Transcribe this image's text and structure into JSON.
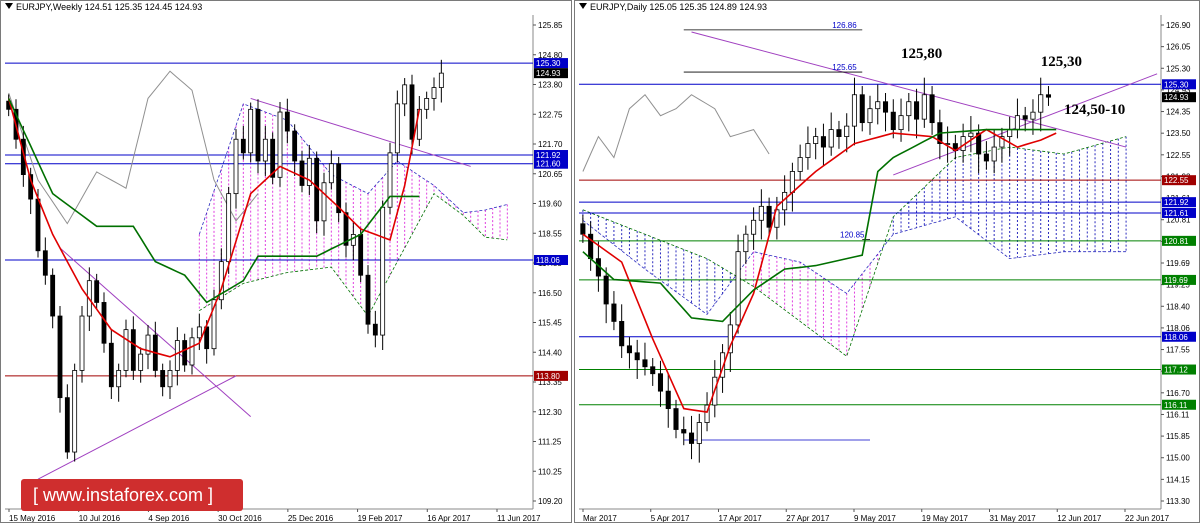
{
  "colors": {
    "price": "#000000",
    "tenkan": "#e00000",
    "kijun": "#007000",
    "chikou": "#909090",
    "cloud_bull": "#2c2cbf",
    "cloud_bear": "#e040e0",
    "trendline": "#a040c0",
    "level_blue": "#0000c8",
    "level_red": "#a00000",
    "level_green": "#008000"
  },
  "watermark": {
    "text": "[ www.instaforex.com ]"
  },
  "chart_data": [
    {
      "type": "candlestick",
      "id": "weekly",
      "title": "EURJPY,Weekly  124.51 125.35 124.45 124.93",
      "ylim": [
        109.2,
        126.7
      ],
      "yticks": [
        "125.85",
        "124.80",
        "123.80",
        "122.75",
        "121.70",
        "120.65",
        "119.60",
        "118.55",
        "117.55",
        "116.50",
        "115.45",
        "114.40",
        "113.35",
        "112.30",
        "111.25",
        "110.25",
        "109.20"
      ],
      "xticks": [
        "15 May 2016",
        "10 Jul 2016",
        "4 Sep 2016",
        "30 Oct 2016",
        "25 Dec 2016",
        "19 Feb 2017",
        "16 Apr 2017",
        "11 Jun 2017"
      ],
      "price_labels": [
        {
          "text": "125.30",
          "value": 125.3,
          "color": "#0000c8"
        },
        {
          "text": "124.93",
          "value": 124.93,
          "color": "#000000"
        },
        {
          "text": "121.92",
          "value": 121.92,
          "color": "#0000c8"
        },
        {
          "text": "121.60",
          "value": 121.6,
          "color": "#0000c8"
        },
        {
          "text": "118.06",
          "value": 118.06,
          "color": "#0000c8"
        },
        {
          "text": "113.80",
          "value": 113.8,
          "color": "#a00000"
        }
      ],
      "hlines": [
        {
          "value": 125.3,
          "color": "#0000c8",
          "x0": 0.0
        },
        {
          "value": 121.92,
          "color": "#0000c8",
          "x0": 0.0
        },
        {
          "value": 121.6,
          "color": "#0000c8",
          "x0": 0.0
        },
        {
          "value": 118.06,
          "color": "#0000c8",
          "x0": 0.0
        },
        {
          "value": 113.8,
          "color": "#a00000",
          "x0": 0.0
        }
      ],
      "closes": [
        123.6,
        122.5,
        121.2,
        120.3,
        118.4,
        117.5,
        116.0,
        113.0,
        111.0,
        114.0,
        116.0,
        117.3,
        116.5,
        115.0,
        113.4,
        114.0,
        115.5,
        114.0,
        114.6,
        115.3,
        114.0,
        113.4,
        114.0,
        115.1,
        114.2,
        115.2,
        115.6,
        114.8,
        116.6,
        118.0,
        120.5,
        122.5,
        122.0,
        123.6,
        121.7,
        122.5,
        121.1,
        123.5,
        122.8,
        121.7,
        120.8,
        121.8,
        119.5,
        120.9,
        121.6,
        119.8,
        118.6,
        119.0,
        117.5,
        115.7,
        115.3,
        120.0,
        122.0,
        123.8,
        124.5,
        122.5,
        123.6,
        124.0,
        124.4,
        124.93
      ],
      "tenkan": [
        {
          "i": 0,
          "v": 124.0
        },
        {
          "i": 3,
          "v": 121.0
        },
        {
          "i": 6,
          "v": 119.0
        },
        {
          "i": 10,
          "v": 117.0
        },
        {
          "i": 14,
          "v": 115.5
        },
        {
          "i": 18,
          "v": 114.8
        },
        {
          "i": 22,
          "v": 114.5
        },
        {
          "i": 26,
          "v": 115.0
        },
        {
          "i": 29,
          "v": 117.0
        },
        {
          "i": 33,
          "v": 120.5
        },
        {
          "i": 37,
          "v": 121.5
        },
        {
          "i": 41,
          "v": 121.0
        },
        {
          "i": 45,
          "v": 120.0
        },
        {
          "i": 48,
          "v": 119.2
        },
        {
          "i": 52,
          "v": 118.8
        },
        {
          "i": 54,
          "v": 120.8
        },
        {
          "i": 56,
          "v": 123.6
        }
      ],
      "kijun": [
        {
          "i": 0,
          "v": 124.0
        },
        {
          "i": 6,
          "v": 120.5
        },
        {
          "i": 12,
          "v": 119.3
        },
        {
          "i": 17,
          "v": 119.3
        },
        {
          "i": 20,
          "v": 118.0
        },
        {
          "i": 24,
          "v": 117.5
        },
        {
          "i": 27,
          "v": 116.5
        },
        {
          "i": 32,
          "v": 117.3
        },
        {
          "i": 34,
          "v": 118.2
        },
        {
          "i": 42,
          "v": 118.2
        },
        {
          "i": 48,
          "v": 119.0
        },
        {
          "i": 52,
          "v": 120.4
        },
        {
          "i": 56,
          "v": 120.4
        }
      ],
      "chikou": [
        {
          "i": 0,
          "v": 124.2
        },
        {
          "i": 4,
          "v": 121.0
        },
        {
          "i": 8,
          "v": 119.4
        },
        {
          "i": 12,
          "v": 121.3
        },
        {
          "i": 16,
          "v": 120.7
        },
        {
          "i": 19,
          "v": 124.0
        },
        {
          "i": 22,
          "v": 125.0
        },
        {
          "i": 25,
          "v": 124.3
        },
        {
          "i": 28,
          "v": 121.0
        },
        {
          "i": 31,
          "v": 119.5
        },
        {
          "i": 34,
          "v": 120.5
        }
      ],
      "cloud": [
        {
          "i": 26,
          "a": 116.2,
          "b": 119.0
        },
        {
          "i": 32,
          "a": 117.2,
          "b": 123.8
        },
        {
          "i": 38,
          "a": 117.6,
          "b": 123.2
        },
        {
          "i": 44,
          "a": 117.8,
          "b": 121.2
        },
        {
          "i": 49,
          "a": 116.0,
          "b": 120.5
        },
        {
          "i": 53,
          "a": 118.0,
          "b": 121.7
        },
        {
          "i": 58,
          "a": 120.5,
          "b": 120.8
        },
        {
          "i": 62,
          "a": 119.7,
          "b": 119.8
        },
        {
          "i": 65,
          "a": 118.9,
          "b": 119.9
        },
        {
          "i": 68,
          "a": 118.8,
          "b": 120.1
        }
      ],
      "trendlines": [
        {
          "i1": 33,
          "v1": 124.0,
          "i2": 63,
          "v2": 121.5
        },
        {
          "i1": 7,
          "v1": 118.5,
          "i2": 33,
          "v2": 112.3
        },
        {
          "i1": 4,
          "v1": 110.0,
          "i2": 31,
          "v2": 113.8
        }
      ],
      "n": 72
    },
    {
      "type": "candlestick",
      "id": "daily",
      "title": "EURJPY,Daily  125.05 125.35 124.89 124.93",
      "ylim": [
        113.35,
        127.0
      ],
      "yticks": [
        "126.90",
        "126.05",
        "125.30",
        "124.93",
        "124.35",
        "123.50",
        "122.55",
        "121.92",
        "121.61",
        "120.81",
        "120.10",
        "119.69",
        "119.25",
        "118.40",
        "118.06",
        "117.55",
        "117.12",
        "116.70",
        "116.11",
        "115.85",
        "115.00",
        "114.15",
        "113.30"
      ],
      "xticks": [
        "Mar 2017",
        "5 Apr 2017",
        "17 Apr 2017",
        "27 Apr 2017",
        "9 May 2017",
        "19 May 2017",
        "31 May 2017",
        "12 Jun 2017",
        "22 Jun 2017"
      ],
      "price_labels": [
        {
          "text": "125.30",
          "value": 125.3,
          "color": "#0000c8"
        },
        {
          "text": "124.93",
          "value": 124.93,
          "color": "#000000"
        },
        {
          "text": "122.55",
          "value": 122.55,
          "color": "#a00000"
        },
        {
          "text": "121.92",
          "value": 121.92,
          "color": "#0000c8"
        },
        {
          "text": "121.61",
          "value": 121.61,
          "color": "#0000c8"
        },
        {
          "text": "120.81",
          "value": 120.81,
          "color": "#008000"
        },
        {
          "text": "119.69",
          "value": 119.69,
          "color": "#008000"
        },
        {
          "text": "118.06",
          "value": 118.06,
          "color": "#0000c8"
        },
        {
          "text": "117.12",
          "value": 117.12,
          "color": "#008000"
        },
        {
          "text": "116.11",
          "value": 116.11,
          "color": "#008000"
        }
      ],
      "hlines": [
        {
          "value": 125.3,
          "color": "#0000c8",
          "x0": 0.0
        },
        {
          "value": 122.55,
          "color": "#a00000",
          "x0": 0.0
        },
        {
          "value": 121.92,
          "color": "#0000c8",
          "x0": 0.0
        },
        {
          "value": 121.61,
          "color": "#0000c8",
          "x0": 0.0
        },
        {
          "value": 120.81,
          "color": "#008000",
          "x0": 0.0
        },
        {
          "value": 119.69,
          "color": "#008000",
          "x0": 0.0
        },
        {
          "value": 118.06,
          "color": "#0000c8",
          "x0": 0.0
        },
        {
          "value": 117.12,
          "color": "#008000",
          "x0": 0.0
        },
        {
          "value": 116.11,
          "color": "#008000",
          "x0": 0.0
        }
      ],
      "closes": [
        121.0,
        120.3,
        119.8,
        119.0,
        118.5,
        117.8,
        117.6,
        117.4,
        117.2,
        117.0,
        116.5,
        116.0,
        115.4,
        115.3,
        115.0,
        115.6,
        116.1,
        116.9,
        117.6,
        118.4,
        120.5,
        121.0,
        121.4,
        121.8,
        121.2,
        121.7,
        122.2,
        122.8,
        123.2,
        123.6,
        123.8,
        123.5,
        124.0,
        123.8,
        124.1,
        125.0,
        124.2,
        124.6,
        124.8,
        124.5,
        124.0,
        124.4,
        124.8,
        124.3,
        125.0,
        124.2,
        123.6,
        123.6,
        123.4,
        123.8,
        123.9,
        123.3,
        123.1,
        123.5,
        123.8,
        124.0,
        124.4,
        124.3,
        124.5,
        125.0,
        124.93
      ],
      "tenkan": [
        {
          "i": 0,
          "v": 121.0
        },
        {
          "i": 5,
          "v": 120.2
        },
        {
          "i": 9,
          "v": 118.0
        },
        {
          "i": 13,
          "v": 116.0
        },
        {
          "i": 16,
          "v": 115.9
        },
        {
          "i": 19,
          "v": 117.8
        },
        {
          "i": 22,
          "v": 119.3
        },
        {
          "i": 25,
          "v": 121.8
        },
        {
          "i": 30,
          "v": 122.8
        },
        {
          "i": 35,
          "v": 123.6
        },
        {
          "i": 40,
          "v": 123.9
        },
        {
          "i": 45,
          "v": 123.8
        },
        {
          "i": 48,
          "v": 123.4
        },
        {
          "i": 52,
          "v": 124.0
        },
        {
          "i": 56,
          "v": 123.5
        },
        {
          "i": 59,
          "v": 123.7
        },
        {
          "i": 61,
          "v": 123.9
        }
      ],
      "kijun": [
        {
          "i": 0,
          "v": 120.5
        },
        {
          "i": 4,
          "v": 119.7
        },
        {
          "i": 10,
          "v": 119.6
        },
        {
          "i": 14,
          "v": 118.6
        },
        {
          "i": 18,
          "v": 118.5
        },
        {
          "i": 22,
          "v": 119.4
        },
        {
          "i": 26,
          "v": 120.0
        },
        {
          "i": 30,
          "v": 120.1
        },
        {
          "i": 36,
          "v": 120.4
        },
        {
          "i": 38,
          "v": 122.8
        },
        {
          "i": 40,
          "v": 123.2
        },
        {
          "i": 46,
          "v": 123.9
        },
        {
          "i": 52,
          "v": 124.0
        },
        {
          "i": 61,
          "v": 124.0
        }
      ],
      "chikou": [
        {
          "i": 0,
          "v": 122.8
        },
        {
          "i": 2,
          "v": 123.8
        },
        {
          "i": 4,
          "v": 123.2
        },
        {
          "i": 6,
          "v": 124.6
        },
        {
          "i": 8,
          "v": 125.0
        },
        {
          "i": 10,
          "v": 124.4
        },
        {
          "i": 12,
          "v": 124.6
        },
        {
          "i": 14,
          "v": 125.0
        },
        {
          "i": 17,
          "v": 124.6
        },
        {
          "i": 19,
          "v": 123.8
        },
        {
          "i": 22,
          "v": 124.0
        },
        {
          "i": 24,
          "v": 123.3
        }
      ],
      "cloud": [
        {
          "i": 0,
          "a": 121.7,
          "b": 121.4
        },
        {
          "i": 8,
          "a": 121.0,
          "b": 120.0
        },
        {
          "i": 16,
          "a": 120.3,
          "b": 118.7
        },
        {
          "i": 22,
          "a": 119.5,
          "b": 120.5
        },
        {
          "i": 28,
          "a": 118.5,
          "b": 120.2
        },
        {
          "i": 34,
          "a": 117.5,
          "b": 119.3
        },
        {
          "i": 40,
          "a": 121.5,
          "b": 121.0
        },
        {
          "i": 48,
          "a": 123.2,
          "b": 121.5
        },
        {
          "i": 55,
          "a": 123.5,
          "b": 120.3
        },
        {
          "i": 62,
          "a": 123.3,
          "b": 120.5
        },
        {
          "i": 70,
          "a": 123.8,
          "b": 120.5
        }
      ],
      "trendlines": [
        {
          "i1": 14,
          "v1": 126.8,
          "i2": 70,
          "v2": 123.5
        },
        {
          "i1": 40,
          "v1": 122.7,
          "i2": 74,
          "v2": 125.6
        }
      ],
      "marks": [
        {
          "text": "126.86",
          "value": 126.86,
          "i1": 13,
          "i2": 36
        },
        {
          "text": "125.65",
          "value": 125.65,
          "i1": 13,
          "i2": 36
        },
        {
          "text": "120.85",
          "value": 120.85,
          "i1": 36,
          "i2": 37
        },
        {
          "text": "",
          "value": 115.1,
          "i1": 13,
          "i2": 37
        }
      ],
      "annotations": [
        "125,80",
        "125,30",
        "124,50-10"
      ],
      "n": 75
    }
  ]
}
